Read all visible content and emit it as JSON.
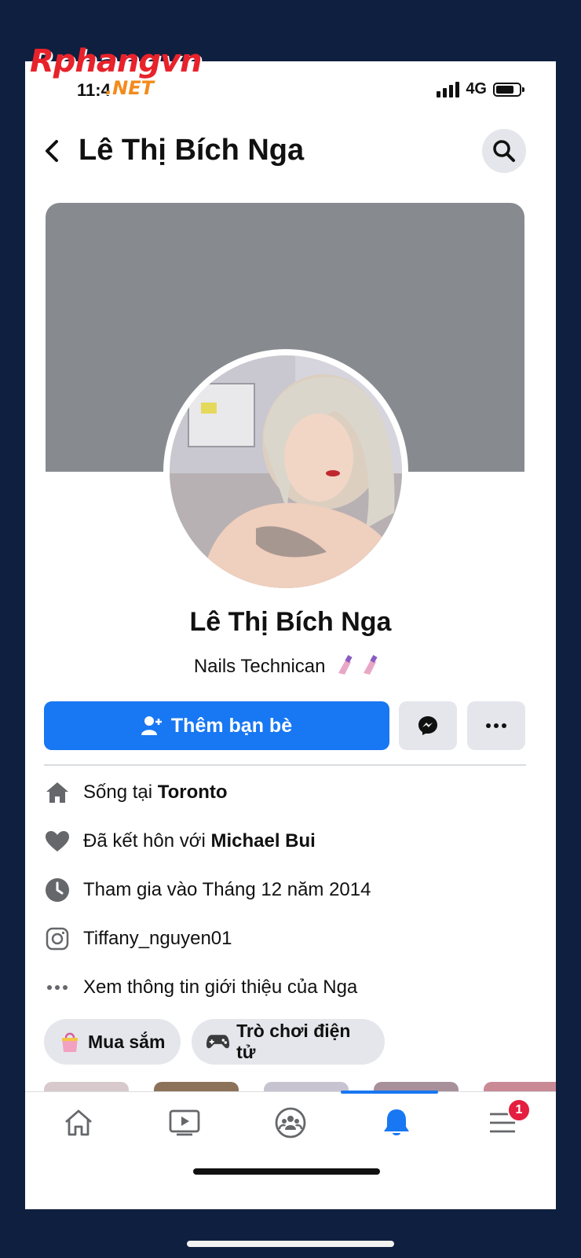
{
  "watermark": {
    "main": "Rphangvn",
    "suffix": ".NET"
  },
  "status_bar": {
    "time": "11:4",
    "network": "4G"
  },
  "header": {
    "title": "Lê Thị Bích Nga"
  },
  "profile": {
    "name": "Lê Thị Bích Nga",
    "bio": "Nails Technican"
  },
  "actions": {
    "add_friend": "Thêm bạn bè"
  },
  "details": {
    "lives_prefix": "Sống tại ",
    "lives_city": "Toronto",
    "married_prefix": "Đã kết hôn với ",
    "married_name": "Michael Bui",
    "joined": "Tham gia vào Tháng 12 năm 2014",
    "instagram": "Tiffany_nguyen01",
    "see_about": "Xem thông tin giới thiệu của Nga"
  },
  "chips": [
    {
      "label": "Mua sắm",
      "icon": "shopping-bag-icon"
    },
    {
      "label": "Trò chơi điện tử",
      "icon": "game-controller-icon"
    }
  ],
  "tabbar": {
    "items": [
      "home-icon",
      "video-icon",
      "groups-icon",
      "notifications-icon",
      "menu-icon"
    ],
    "active": "notifications-icon",
    "menu_badge": "1"
  },
  "colors": {
    "accent": "#1877f2",
    "cover": "#878b90",
    "badge": "#e41e3f",
    "background": "#0f1f3f"
  }
}
